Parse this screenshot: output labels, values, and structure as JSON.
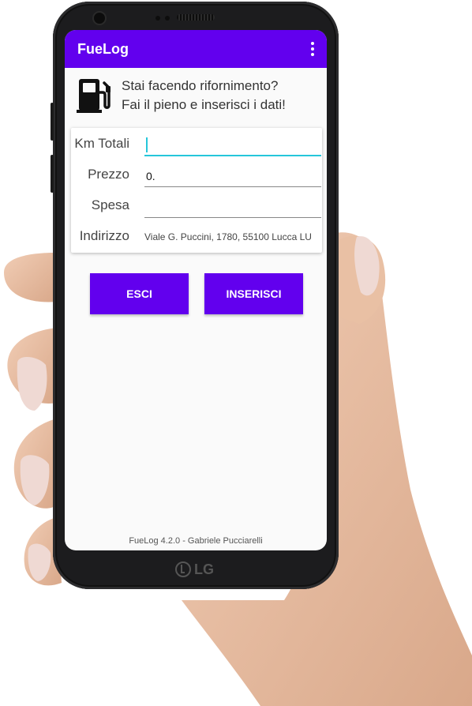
{
  "app": {
    "title": "FueLog"
  },
  "header": {
    "icon": "fuel-pump-icon",
    "line1": "Stai facendo rifornimento?",
    "line2": "Fai il pieno e inserisci i dati!"
  },
  "form": {
    "km": {
      "label": "Km Totali",
      "value": ""
    },
    "price": {
      "label": "Prezzo",
      "value": "0."
    },
    "spend": {
      "label": "Spesa",
      "value": ""
    },
    "address": {
      "label": "Indirizzo",
      "value": "Viale G. Puccini, 1780, 55100 Lucca LU"
    }
  },
  "buttons": {
    "exit": "ESCI",
    "insert": "INSERISCI"
  },
  "footer": "FueLog 4.2.0 - Gabriele Pucciarelli",
  "device": {
    "brand": "LG"
  },
  "colors": {
    "primary": "#6200ee",
    "accent": "#26c6da",
    "background": "#fafafa"
  }
}
